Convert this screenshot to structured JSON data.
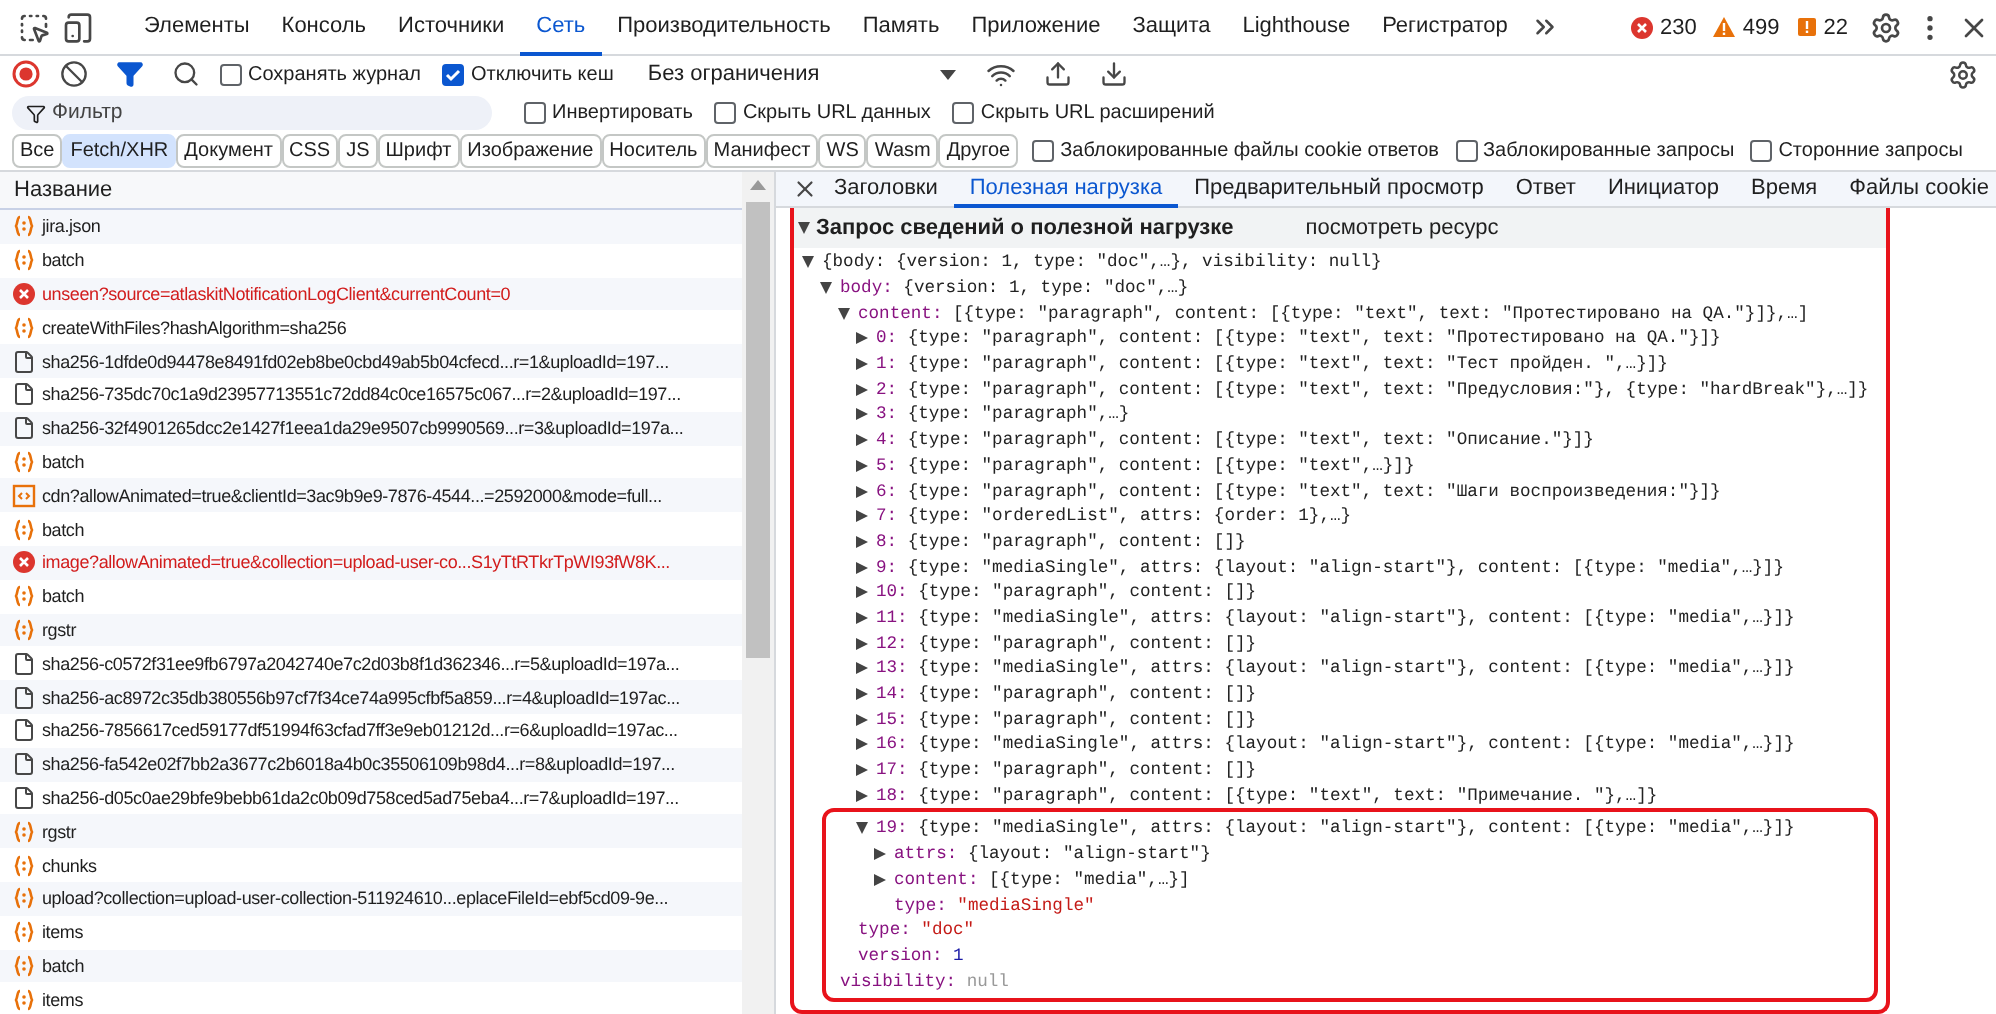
{
  "panel_tabs": [
    {
      "label": "Элементы",
      "selected": false
    },
    {
      "label": "Консоль",
      "selected": false
    },
    {
      "label": "Источники",
      "selected": false
    },
    {
      "label": "Сеть",
      "selected": true
    },
    {
      "label": "Производительность",
      "selected": false
    },
    {
      "label": "Память",
      "selected": false
    },
    {
      "label": "Приложение",
      "selected": false
    },
    {
      "label": "Защита",
      "selected": false
    },
    {
      "label": "Lighthouse",
      "selected": false
    },
    {
      "label": "Регистратор",
      "selected": false
    }
  ],
  "counters": [
    {
      "kind": "error",
      "count": "230"
    },
    {
      "kind": "warning",
      "count": "499"
    },
    {
      "kind": "issue",
      "count": "22"
    }
  ],
  "toolbar": {
    "preserve_log": {
      "label": "Сохранять журнал",
      "checked": false
    },
    "disable_cache": {
      "label": "Отключить кеш",
      "checked": true
    },
    "throttling": "Без ограничения"
  },
  "filter": {
    "placeholder": "Фильтр",
    "options": [
      {
        "label": "Инвертировать",
        "checked": false
      },
      {
        "label": "Скрыть URL данных",
        "checked": false
      },
      {
        "label": "Скрыть URL расширений",
        "checked": false
      }
    ]
  },
  "type_filters": [
    {
      "label": "Все",
      "selected": false
    },
    {
      "label": "Fetch/XHR",
      "selected": true
    },
    {
      "label": "Документ",
      "selected": false
    },
    {
      "label": "CSS",
      "selected": false
    },
    {
      "label": "JS",
      "selected": false
    },
    {
      "label": "Шрифт",
      "selected": false
    },
    {
      "label": "Изображение",
      "selected": false
    },
    {
      "label": "Носитель",
      "selected": false
    },
    {
      "label": "Манифест",
      "selected": false
    },
    {
      "label": "WS",
      "selected": false
    },
    {
      "label": "Wasm",
      "selected": false
    },
    {
      "label": "Другое",
      "selected": false
    }
  ],
  "type_options": [
    {
      "label": "Заблокированные файлы cookie ответов",
      "checked": false
    },
    {
      "label": "Заблокированные запросы",
      "checked": false
    },
    {
      "label": "Сторонние запросы",
      "checked": false
    }
  ],
  "requests": {
    "column": "Название",
    "rows": [
      {
        "kind": "xhr",
        "name": "jira.json"
      },
      {
        "kind": "xhr",
        "name": "batch"
      },
      {
        "kind": "error",
        "name": "unseen?source=atlaskitNotificationLogClient&currentCount=0"
      },
      {
        "kind": "xhr",
        "name": "createWithFiles?hashAlgorithm=sha256"
      },
      {
        "kind": "doc",
        "name": "sha256-1dfde0d94478e8491fd02eb8be0cbd49ab5b04cfecd...r=1&uploadId=197..."
      },
      {
        "kind": "doc",
        "name": "sha256-735dc70c1a9d23957713551c72dd84c0ce16575c067...r=2&uploadId=197..."
      },
      {
        "kind": "doc",
        "name": "sha256-32f4901265dcc2e1427f1eea1da29e9507cb9990569...r=3&uploadId=197a..."
      },
      {
        "kind": "xhr",
        "name": "batch"
      },
      {
        "kind": "image",
        "name": "cdn?allowAnimated=true&clientId=3ac9b9e9-7876-4544...=2592000&mode=full..."
      },
      {
        "kind": "xhr",
        "name": "batch"
      },
      {
        "kind": "error",
        "name": "image?allowAnimated=true&collection=upload-user-co...S1yTtRTkrTpWI93fW8K..."
      },
      {
        "kind": "xhr",
        "name": "batch"
      },
      {
        "kind": "xhr",
        "name": "rgstr"
      },
      {
        "kind": "doc",
        "name": "sha256-c0572f31ee9fb6797a2042740e7c2d03b8f1d362346...r=5&uploadId=197a..."
      },
      {
        "kind": "doc",
        "name": "sha256-ac8972c35db380556b97cf7f34ce74a995cfbf5a859...r=4&uploadId=197ac..."
      },
      {
        "kind": "doc",
        "name": "sha256-7856617ced59177df51994f63cfad7ff3e9eb01212d...r=6&uploadId=197ac..."
      },
      {
        "kind": "doc",
        "name": "sha256-fa542e02f7bb2a3677c2b6018a4b0c35506109b98d4...r=8&uploadId=197..."
      },
      {
        "kind": "doc",
        "name": "sha256-d05c0ae29bfe9bebb61da2c0b09d758ced5ad75eba4...r=7&uploadId=197..."
      },
      {
        "kind": "xhr",
        "name": "rgstr"
      },
      {
        "kind": "xhr",
        "name": "chunks"
      },
      {
        "kind": "xhr",
        "name": "upload?collection=upload-user-collection-511924610...eplaceFileId=ebf5cd09-9e..."
      },
      {
        "kind": "xhr",
        "name": "items"
      },
      {
        "kind": "xhr",
        "name": "batch"
      },
      {
        "kind": "xhr",
        "name": "items"
      }
    ]
  },
  "detail_tabs": [
    {
      "label": "Заголовки",
      "selected": false
    },
    {
      "label": "Полезная нагрузка",
      "selected": true
    },
    {
      "label": "Предварительный просмотр",
      "selected": false
    },
    {
      "label": "Ответ",
      "selected": false
    },
    {
      "label": "Инициатор",
      "selected": false
    },
    {
      "label": "Время",
      "selected": false
    },
    {
      "label": "Файлы cookie",
      "selected": false
    }
  ],
  "payload": {
    "title": "Запрос сведений о полезной нагрузке",
    "link": "посмотреть ресурс",
    "tree": {
      "kind": "object",
      "preview": "{body: {version: 1, type: \"doc\",…}, visibility: null}",
      "expanded": true,
      "children": [
        {
          "kind": "object",
          "key": "body:",
          "preview": "{version: 1, type: \"doc\",…}",
          "expanded": true,
          "children": [
            {
              "kind": "object",
              "key": "content:",
              "preview": "[{type: \"paragraph\", content: [{type: \"text\", text: \"Протестировано на QA.\"}]},…]",
              "expanded": true,
              "children": [
                {
                  "kind": "object",
                  "key": "0:",
                  "preview": "{type: \"paragraph\", content: [{type: \"text\", text: \"Протестировано на QA.\"}]}",
                  "expanded": false
                },
                {
                  "kind": "object",
                  "key": "1:",
                  "preview": "{type: \"paragraph\", content: [{type: \"text\", text: \"Тест пройден. \",…}]}",
                  "expanded": false
                },
                {
                  "kind": "object",
                  "key": "2:",
                  "preview": "{type: \"paragraph\", content: [{type: \"text\", text: \"Предусловия:\"}, {type: \"hardBreak\"},…]}",
                  "expanded": false
                },
                {
                  "kind": "object",
                  "key": "3:",
                  "preview": "{type: \"paragraph\",…}",
                  "expanded": false
                },
                {
                  "kind": "object",
                  "key": "4:",
                  "preview": "{type: \"paragraph\", content: [{type: \"text\", text: \"Описание.\"}]}",
                  "expanded": false
                },
                {
                  "kind": "object",
                  "key": "5:",
                  "preview": "{type: \"paragraph\", content: [{type: \"text\",…}]}",
                  "expanded": false
                },
                {
                  "kind": "object",
                  "key": "6:",
                  "preview": "{type: \"paragraph\", content: [{type: \"text\", text: \"Шаги воспроизведения:\"}]}",
                  "expanded": false
                },
                {
                  "kind": "object",
                  "key": "7:",
                  "preview": "{type: \"orderedList\", attrs: {order: 1},…}",
                  "expanded": false
                },
                {
                  "kind": "object",
                  "key": "8:",
                  "preview": "{type: \"paragraph\", content: []}",
                  "expanded": false
                },
                {
                  "kind": "object",
                  "key": "9:",
                  "preview": "{type: \"mediaSingle\", attrs: {layout: \"align-start\"}, content: [{type: \"media\",…}]}",
                  "expanded": false
                },
                {
                  "kind": "object",
                  "key": "10:",
                  "preview": "{type: \"paragraph\", content: []}",
                  "expanded": false
                },
                {
                  "kind": "object",
                  "key": "11:",
                  "preview": "{type: \"mediaSingle\", attrs: {layout: \"align-start\"}, content: [{type: \"media\",…}]}",
                  "expanded": false
                },
                {
                  "kind": "object",
                  "key": "12:",
                  "preview": "{type: \"paragraph\", content: []}",
                  "expanded": false
                },
                {
                  "kind": "object",
                  "key": "13:",
                  "preview": "{type: \"mediaSingle\", attrs: {layout: \"align-start\"}, content: [{type: \"media\",…}]}",
                  "expanded": false
                },
                {
                  "kind": "object",
                  "key": "14:",
                  "preview": "{type: \"paragraph\", content: []}",
                  "expanded": false
                },
                {
                  "kind": "object",
                  "key": "15:",
                  "preview": "{type: \"paragraph\", content: []}",
                  "expanded": false
                },
                {
                  "kind": "object",
                  "key": "16:",
                  "preview": "{type: \"mediaSingle\", attrs: {layout: \"align-start\"}, content: [{type: \"media\",…}]}",
                  "expanded": false
                },
                {
                  "kind": "object",
                  "key": "17:",
                  "preview": "{type: \"paragraph\", content: []}",
                  "expanded": false
                },
                {
                  "kind": "object",
                  "key": "18:",
                  "preview": "{type: \"paragraph\", content: [{type: \"text\", text: \"Примечание. \"},…]}",
                  "expanded": false
                },
                {
                  "kind": "object",
                  "key": "19:",
                  "preview": "{type: \"mediaSingle\", attrs: {layout: \"align-start\"}, content: [{type: \"media\",…}]}",
                  "expanded": true,
                  "highlighted": true,
                  "children": [
                    {
                      "kind": "object",
                      "key": "attrs:",
                      "preview": "{layout: \"align-start\"}",
                      "expanded": false
                    },
                    {
                      "kind": "object",
                      "key": "content:",
                      "preview": "[{type: \"media\",…}]",
                      "expanded": false
                    },
                    {
                      "kind": "string",
                      "key": "type:",
                      "preview": "\"mediaSingle\""
                    }
                  ]
                }
              ]
            },
            {
              "kind": "string",
              "key": "type:",
              "preview": "\"doc\""
            },
            {
              "kind": "number",
              "key": "version:",
              "preview": "1"
            }
          ]
        },
        {
          "kind": "null",
          "key": "visibility:",
          "preview": "null"
        }
      ]
    }
  }
}
